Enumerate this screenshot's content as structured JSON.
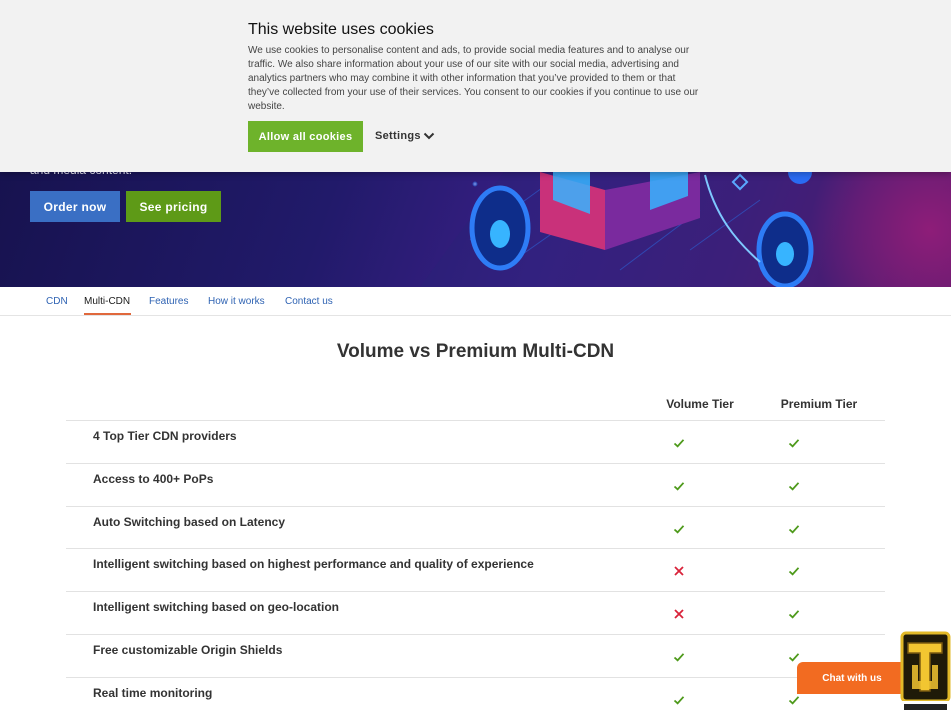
{
  "hero": {
    "subtitle": "and media content.",
    "order_label": "Order now",
    "pricing_label": "See pricing"
  },
  "subnav": {
    "items": [
      "CDN",
      "Multi-CDN",
      "Features",
      "How it works",
      "Contact us"
    ],
    "active": "Multi-CDN"
  },
  "comparison": {
    "title": "Volume vs Premium Multi-CDN",
    "columns": [
      "Volume Tier",
      "Premium Tier"
    ],
    "rows": [
      {
        "feature": "4 Top Tier CDN providers",
        "volume": "check",
        "premium": "check"
      },
      {
        "feature": "Access to 400+ PoPs",
        "volume": "check",
        "premium": "check"
      },
      {
        "feature": "Auto Switching based on Latency",
        "volume": "check",
        "premium": "check"
      },
      {
        "feature": "Intelligent switching based on highest performance and quality of experience",
        "volume": "cross",
        "premium": "check"
      },
      {
        "feature": "Intelligent switching based on geo-location",
        "volume": "cross",
        "premium": "check"
      },
      {
        "feature": "Free customizable Origin Shields",
        "volume": "check",
        "premium": "check"
      },
      {
        "feature": "Real time monitoring",
        "volume": "check",
        "premium": "check"
      }
    ]
  },
  "cookie": {
    "title": "This website uses cookies",
    "body": "We use cookies to personalise content and ads, to provide social media features and to analyse our traffic. We also share information about your use of our site with our social media, advertising and analytics partners who may combine it with other information that you’ve provided to them or that they’ve collected from your use of their services. You consent to our cookies if you continue to use our website.",
    "allow_label": "Allow all cookies",
    "settings_label": "Settings"
  },
  "chat": {
    "label": "Chat with us"
  },
  "colors": {
    "order": "#3a6fc4",
    "pricing": "#5e9a17",
    "allow": "#6eb32b",
    "check": "#4e9a1b",
    "cross": "#d9233a",
    "chat": "#f26b21",
    "active_underline": "#e0683c"
  },
  "icons": {
    "check": "check-icon",
    "cross": "cross-icon",
    "settings": "chevron-down-icon"
  }
}
